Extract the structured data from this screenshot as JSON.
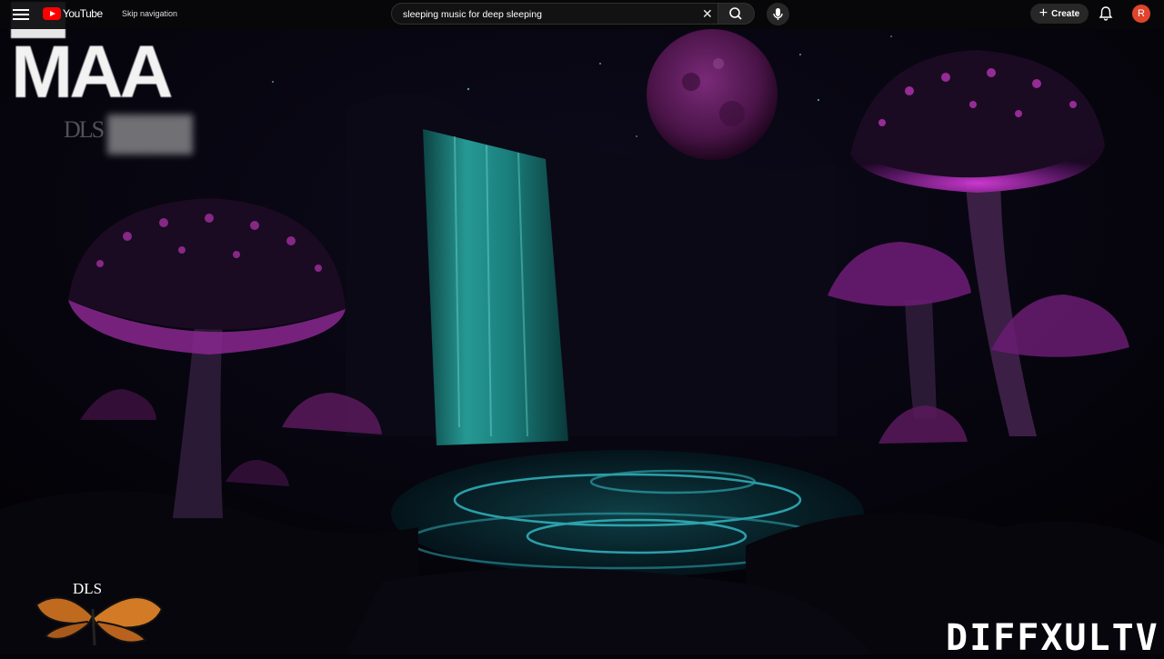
{
  "masthead": {
    "logo_text": "YouTube",
    "skip_navigation": "Skip navigation",
    "search": {
      "value": "sleeping music for deep sleeping",
      "placeholder": "Search"
    },
    "create_label": "Create",
    "avatar_initial": "R"
  },
  "overlay": {
    "watermark_big": "MAA",
    "watermark_small": "DLS",
    "bottom_left_tag": "DLS",
    "channel_watermark": "DIFFXULTV"
  },
  "colors": {
    "brand_red": "#ff0000",
    "avatar": "#e0442c",
    "mushroom_glow": "#c030c8",
    "waterfall": "#2fc9c0"
  }
}
